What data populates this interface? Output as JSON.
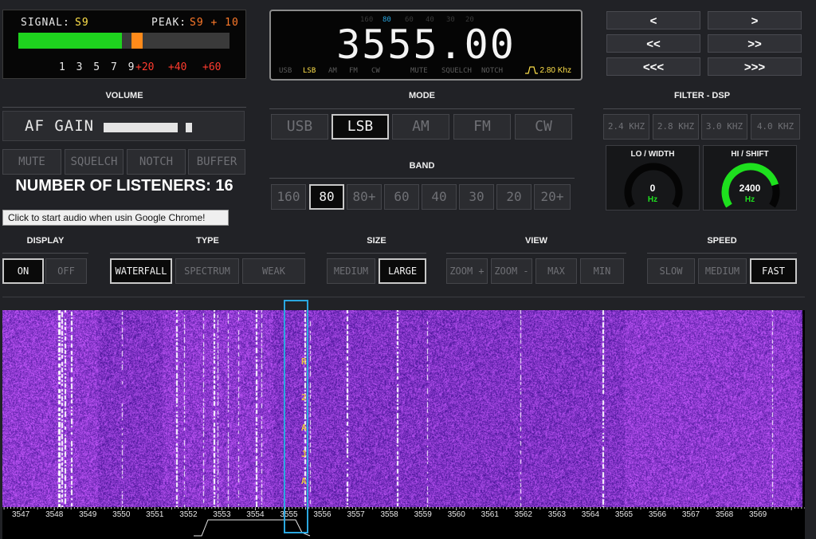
{
  "smeter": {
    "signal_label": "SIGNAL:",
    "signal_value": "S9",
    "peak_label": "PEAK:",
    "peak_value": "S9 + 10",
    "level_fraction": 0.49,
    "peak_fraction": 0.535,
    "scale_s": "1 3 5 7 9",
    "scale_plus": [
      "+20",
      "+40",
      "+60"
    ]
  },
  "radio": {
    "frequency": "3555.00",
    "mode_indicators": [
      "USB",
      "LSB",
      "AM",
      "FM",
      "CW",
      "MUTE",
      "SQUELCH",
      "NOTCH"
    ],
    "active_mode_indicator": "LSB",
    "band_indicators": [
      "160",
      "80",
      "60",
      "40",
      "30",
      "20"
    ],
    "active_band_indicator": "80",
    "filter_readout": "2.80 Khz"
  },
  "nav": {
    "tune_down_1": "<",
    "tune_up_1": ">",
    "tune_down_2": "<<",
    "tune_up_2": ">>",
    "tune_down_3": "<<<",
    "tune_up_3": ">>>"
  },
  "volume": {
    "title": "VOLUME",
    "af_gain_label": "AF GAIN",
    "af_gain_level": 0.85,
    "buttons": [
      "MUTE",
      "SQUELCH",
      "NOTCH",
      "BUFFER"
    ]
  },
  "listeners": {
    "label": "NUMBER OF LISTENERS: 16"
  },
  "chrome_hint": "Click to start audio when usin Google Chrome!",
  "mode": {
    "title": "MODE",
    "buttons": [
      "USB",
      "LSB",
      "AM",
      "FM",
      "CW"
    ],
    "active": "LSB"
  },
  "band": {
    "title": "BAND",
    "buttons": [
      "160",
      "80",
      "80+",
      "60",
      "40",
      "30",
      "20",
      "20+"
    ],
    "active": "80"
  },
  "filter": {
    "title": "FILTER - DSP",
    "buttons": [
      "2.4 KHZ",
      "2.8 KHZ",
      "3.0 KHZ",
      "4.0 KHZ"
    ],
    "lo_title": "LO / WIDTH",
    "lo_value": "0",
    "lo_unit": "Hz",
    "lo_fraction": 0.0,
    "hi_title": "HI / SHIFT",
    "hi_value": "2400",
    "hi_unit": "Hz",
    "hi_fraction": 0.8
  },
  "display": {
    "title": "DISPLAY",
    "buttons": [
      "ON",
      "OFF"
    ],
    "active": "ON"
  },
  "type": {
    "title": "TYPE",
    "buttons": [
      "WATERFALL",
      "SPECTRUM",
      "WEAK"
    ],
    "active": "WATERFALL"
  },
  "size": {
    "title": "SIZE",
    "buttons": [
      "MEDIUM",
      "LARGE"
    ],
    "active": "LARGE"
  },
  "view": {
    "title": "VIEW",
    "buttons": [
      "ZOOM +",
      "ZOOM -",
      "MAX",
      "MIN"
    ]
  },
  "speed": {
    "title": "SPEED",
    "buttons": [
      "SLOW",
      "MEDIUM",
      "FAST"
    ],
    "active": "FAST"
  },
  "waterfall": {
    "cw_letters": [
      "R",
      "2",
      "A",
      "J",
      "A"
    ],
    "freq_ticks": [
      "3547",
      "3548",
      "3549",
      "3550",
      "3551",
      "3552",
      "3553",
      "3554",
      "3555",
      "3556",
      "3557",
      "3558",
      "3559",
      "3560",
      "3561",
      "3562",
      "3563",
      "3564",
      "3565",
      "3566",
      "3567",
      "3568",
      "3569"
    ],
    "freq_start": 3546.45,
    "freq_end": 3570.4,
    "colors": {
      "bg": "#6c22c9",
      "signal": "#ffffff",
      "marker": "#2aa7e0"
    }
  }
}
